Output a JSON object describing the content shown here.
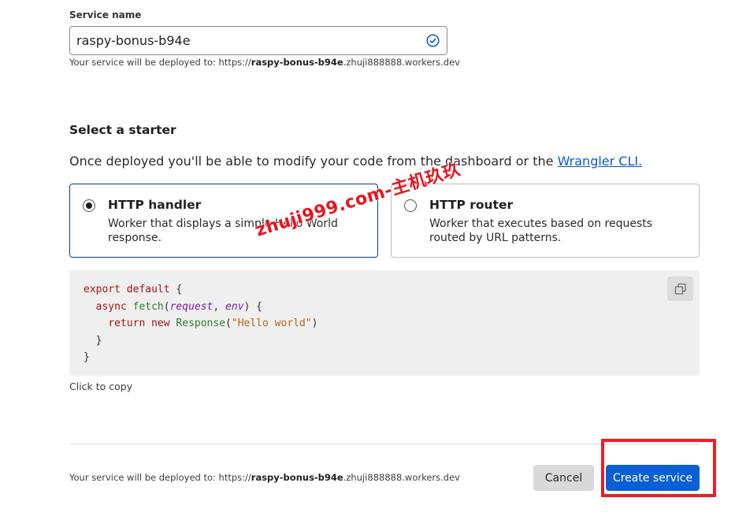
{
  "service_name": {
    "label": "Service name",
    "value": "raspy-bonus-b94e",
    "valid_icon": "check-circle-icon",
    "hint_prefix": "Your service will be deployed to: https://",
    "hint_name": "raspy-bonus-b94e",
    "hint_suffix": ".zhuji888888.workers.dev"
  },
  "starter": {
    "title": "Select a starter",
    "description": "Once deployed you'll be able to modify your code from the dashboard or the ",
    "link_text": "Wrangler CLI.",
    "options": [
      {
        "title": "HTTP handler",
        "description": "Worker that displays a simple Hello World response.",
        "selected": true
      },
      {
        "title": "HTTP router",
        "description": "Worker that executes based on requests routed by URL patterns.",
        "selected": false
      }
    ]
  },
  "watermark": "zhuji999.com-主机玖玖",
  "code": {
    "tokens": {
      "export": "export",
      "default": "default",
      "async": "async",
      "fetch": "fetch",
      "param1": "request",
      "param2": "env",
      "return": "return",
      "new": "new",
      "response": "Response",
      "string": "\"Hello world\""
    },
    "copy_icon": "copy-icon",
    "copy_label": "Click to copy"
  },
  "footer": {
    "hint_prefix": "Your service will be deployed to: https://",
    "hint_name": "raspy-bonus-b94e",
    "hint_suffix": ".zhuji888888.workers.dev",
    "cancel_label": "Cancel",
    "create_label": "Create service"
  },
  "colors": {
    "accent": "#0b5fd6",
    "link": "#0b57d0",
    "highlight": "#ee1c25",
    "watermark": "#e8141e"
  }
}
